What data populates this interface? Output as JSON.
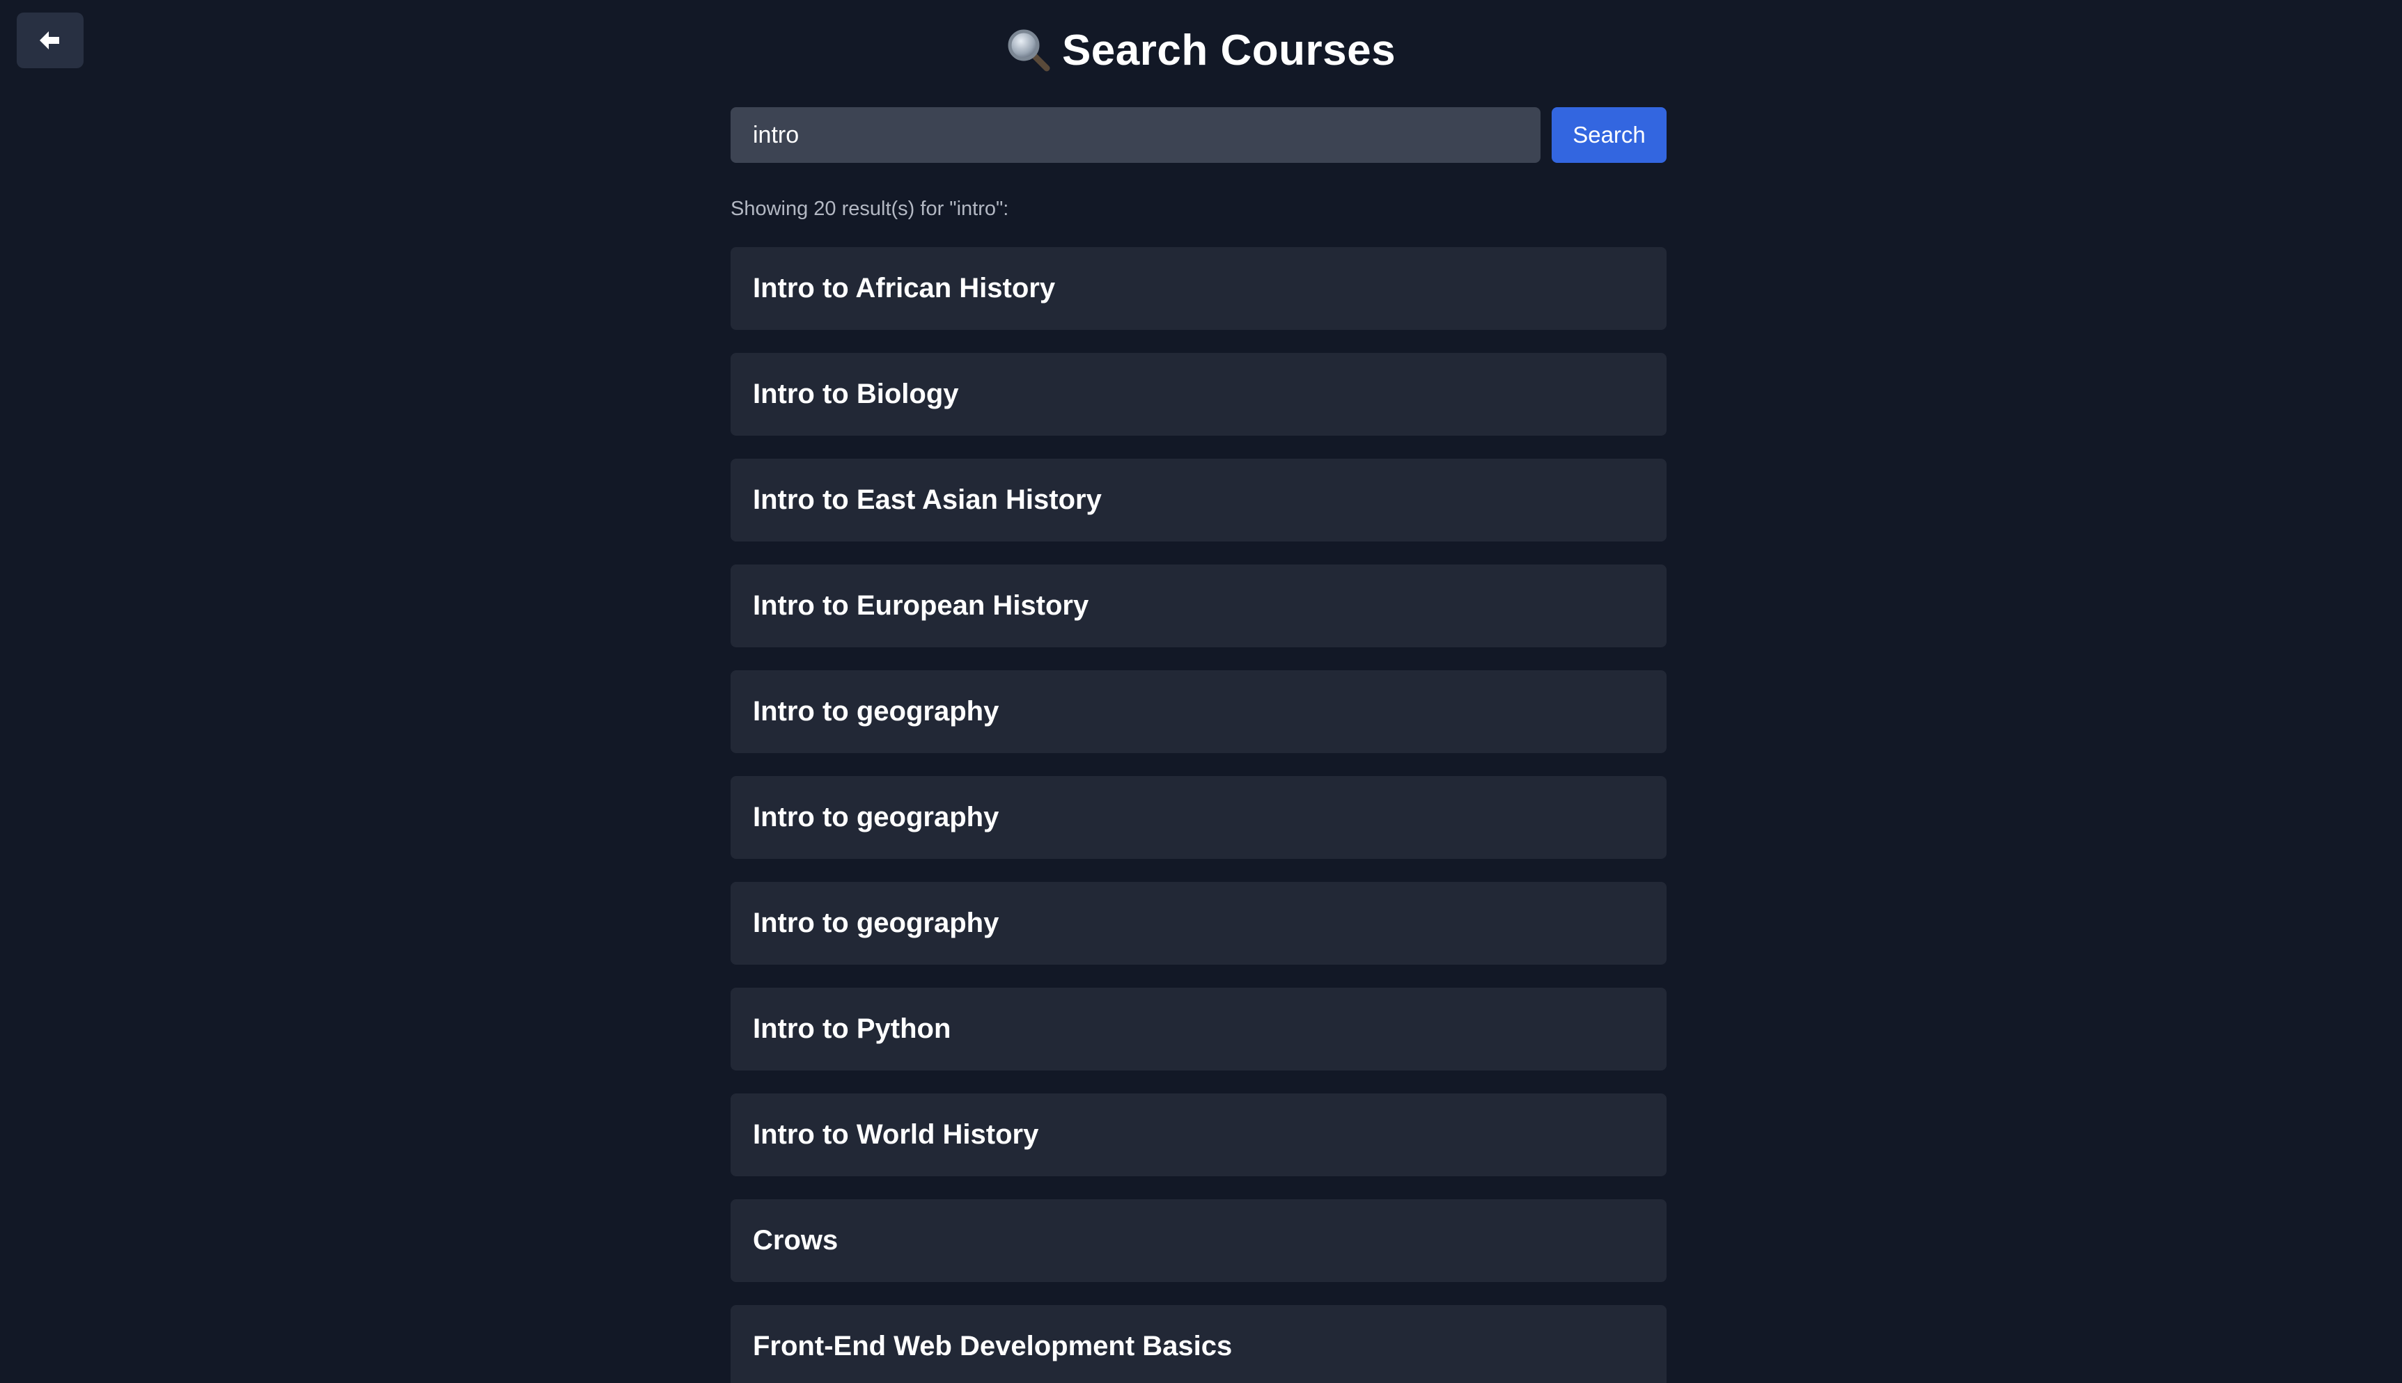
{
  "header": {
    "title": "Search Courses",
    "icon": "magnifying-glass-icon"
  },
  "back_button": {
    "icon": "arrow-left-icon"
  },
  "search": {
    "value": "intro",
    "button_label": "Search"
  },
  "results": {
    "summary": "Showing 20 result(s) for \"intro\":",
    "items": [
      {
        "title": "Intro to African History"
      },
      {
        "title": "Intro to Biology"
      },
      {
        "title": "Intro to East Asian History"
      },
      {
        "title": "Intro to European History"
      },
      {
        "title": "Intro to geography"
      },
      {
        "title": "Intro to geography"
      },
      {
        "title": "Intro to geography"
      },
      {
        "title": "Intro to Python"
      },
      {
        "title": "Intro to World History"
      },
      {
        "title": "Crows"
      },
      {
        "title": "Front-End Web Development Basics"
      }
    ]
  },
  "colors": {
    "background": "#121826",
    "card": "#222836",
    "input": "#3d4453",
    "accent": "#3366e0"
  }
}
